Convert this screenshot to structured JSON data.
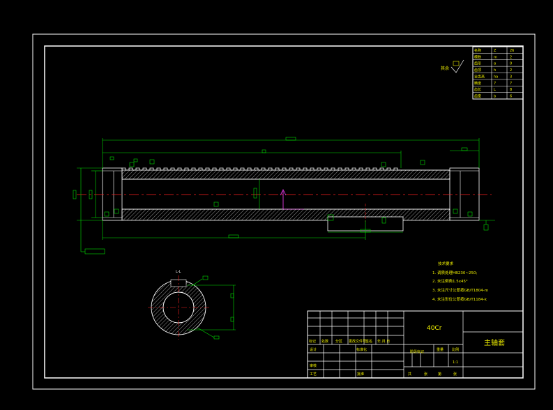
{
  "drawing": {
    "material": "40Cr",
    "part_name": "主轴套",
    "scale": "1:1",
    "section_label": "L-L",
    "roughness_symbol_note": "其余"
  },
  "technical_notes": {
    "heading": "技术要求",
    "items": [
      "1. 调质处理HB230~250;",
      "2. 未注倒角1.5x45°",
      "3. 未注尺寸公差按GB/T1804-m",
      "4. 未注形位公差按GB/T1184-k"
    ]
  },
  "title_block": {
    "row_labels": [
      "标记",
      "处数",
      "分区",
      "更改文件号",
      "签名",
      "年.月.日"
    ],
    "designer": "设计",
    "standardization": "标准化",
    "stage_mark": "阶段标记",
    "weight": "重量",
    "ratio": "比例",
    "audit": "审核",
    "process": "工艺",
    "approve": "批准",
    "sheet": [
      "共",
      "张",
      "第",
      "张"
    ]
  },
  "gear_table": {
    "rows": [
      [
        "名称",
        "Z",
        "26"
      ],
      [
        "模数",
        "m",
        "2"
      ],
      [
        "齿形",
        "α",
        "0"
      ],
      [
        "齿顶",
        "h",
        "2"
      ],
      [
        "全齿高",
        "ha",
        "3"
      ],
      [
        "精度",
        "7",
        "7"
      ],
      [
        "齿长",
        "L",
        "8"
      ],
      [
        "齿宽",
        "b",
        "6"
      ]
    ]
  }
}
